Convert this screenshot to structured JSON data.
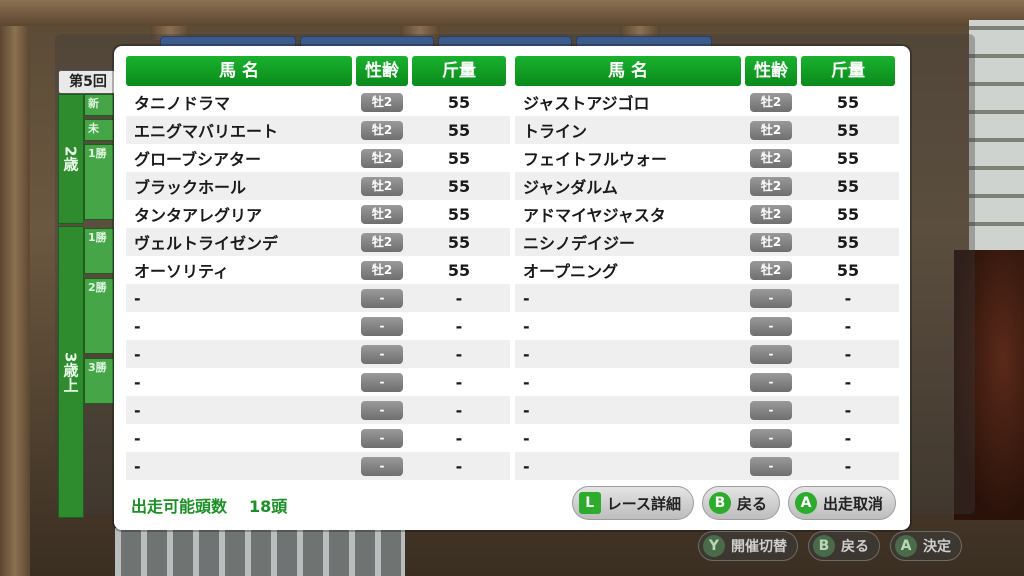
{
  "background": {
    "round_label": "第5回",
    "age_groups": [
      {
        "label": "2歳"
      },
      {
        "label": "3歳上"
      }
    ],
    "grades": [
      "新",
      "未",
      "1勝",
      "1勝",
      "2勝",
      "3勝"
    ]
  },
  "headers": {
    "name": "馬 名",
    "sex_age": "性齢",
    "weight": "斤量"
  },
  "left_table": [
    {
      "name": "タニノドラマ",
      "sex": "牡2",
      "weight": "55"
    },
    {
      "name": "エニグマバリエート",
      "sex": "牡2",
      "weight": "55"
    },
    {
      "name": "グローブシアター",
      "sex": "牡2",
      "weight": "55"
    },
    {
      "name": "ブラックホール",
      "sex": "牡2",
      "weight": "55"
    },
    {
      "name": "タンタアレグリア",
      "sex": "牡2",
      "weight": "55"
    },
    {
      "name": "ヴェルトライゼンデ",
      "sex": "牡2",
      "weight": "55"
    },
    {
      "name": "オーソリティ",
      "sex": "牡2",
      "weight": "55"
    },
    {
      "name": "-",
      "sex": "-",
      "weight": "-"
    },
    {
      "name": "-",
      "sex": "-",
      "weight": "-"
    },
    {
      "name": "-",
      "sex": "-",
      "weight": "-"
    },
    {
      "name": "-",
      "sex": "-",
      "weight": "-"
    },
    {
      "name": "-",
      "sex": "-",
      "weight": "-"
    },
    {
      "name": "-",
      "sex": "-",
      "weight": "-"
    },
    {
      "name": "-",
      "sex": "-",
      "weight": "-"
    }
  ],
  "right_table": [
    {
      "name": "ジャストアジゴロ",
      "sex": "牡2",
      "weight": "55"
    },
    {
      "name": "トライン",
      "sex": "牡2",
      "weight": "55"
    },
    {
      "name": "フェイトフルウォー",
      "sex": "牡2",
      "weight": "55"
    },
    {
      "name": "ジャンダルム",
      "sex": "牡2",
      "weight": "55"
    },
    {
      "name": "アドマイヤジャスタ",
      "sex": "牡2",
      "weight": "55"
    },
    {
      "name": "ニシノデイジー",
      "sex": "牡2",
      "weight": "55"
    },
    {
      "name": "オープニング",
      "sex": "牡2",
      "weight": "55"
    },
    {
      "name": "-",
      "sex": "-",
      "weight": "-"
    },
    {
      "name": "-",
      "sex": "-",
      "weight": "-"
    },
    {
      "name": "-",
      "sex": "-",
      "weight": "-"
    },
    {
      "name": "-",
      "sex": "-",
      "weight": "-"
    },
    {
      "name": "-",
      "sex": "-",
      "weight": "-"
    },
    {
      "name": "-",
      "sex": "-",
      "weight": "-"
    },
    {
      "name": "-",
      "sex": "-",
      "weight": "-"
    }
  ],
  "count": {
    "label": "出走可能頭数",
    "value": "18頭"
  },
  "buttons": [
    {
      "key": "L",
      "label": "レース詳細",
      "icon": "l-button-icon"
    },
    {
      "key": "B",
      "label": "戻る",
      "icon": "b-button-icon"
    },
    {
      "key": "A",
      "label": "出走取消",
      "icon": "a-button-icon"
    }
  ],
  "footer": [
    {
      "key": "Y",
      "label": "開催切替",
      "icon": "y-button-icon"
    },
    {
      "key": "B",
      "label": "戻る",
      "icon": "b-button-icon"
    },
    {
      "key": "A",
      "label": "決定",
      "icon": "a-button-icon"
    }
  ],
  "colors": {
    "header_green": "#0e9b22",
    "count_green": "#1e8f28",
    "pill_gray": "#7e7e7e"
  }
}
